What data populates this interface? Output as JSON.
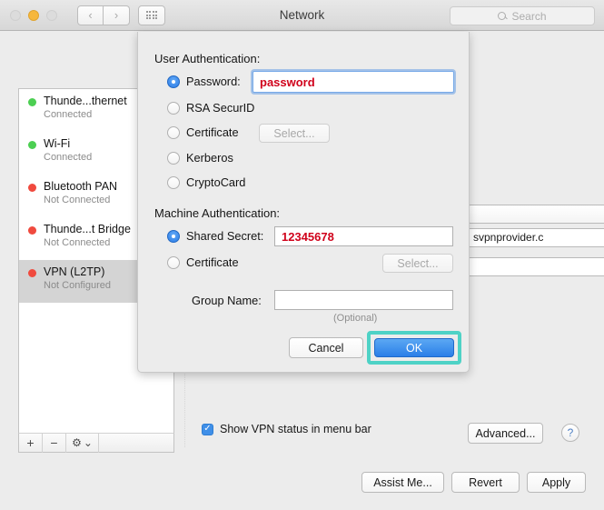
{
  "titlebar": {
    "title": "Network",
    "search_placeholder": "Search",
    "back_glyph": "‹",
    "forward_glyph": "›"
  },
  "sidebar": {
    "services": [
      {
        "name": "Thunde...thernet",
        "status": "Connected",
        "state": "green"
      },
      {
        "name": "Wi-Fi",
        "status": "Connected",
        "state": "green"
      },
      {
        "name": "Bluetooth PAN",
        "status": "Not Connected",
        "state": "red"
      },
      {
        "name": "Thunde...t Bridge",
        "status": "Not Connected",
        "state": "red"
      },
      {
        "name": "VPN (L2TP)",
        "status": "Not Configured",
        "state": "red"
      }
    ],
    "toolbar": {
      "add": "+",
      "remove": "−",
      "gear": "⚙",
      "gear_chevron": "⌄"
    }
  },
  "background_pane": {
    "server_address_value": "svpnprovider.c",
    "ellipsis_button": "..."
  },
  "footer": {
    "show_vpn_status_label": "Show VPN status in menu bar",
    "show_vpn_status_checked": true,
    "check_glyph": "✓",
    "advanced_label": "Advanced...",
    "help_label": "?",
    "assist_me_label": "Assist Me...",
    "revert_label": "Revert",
    "apply_label": "Apply"
  },
  "dialog": {
    "user_auth_title": "User Authentication:",
    "user_auth_options": [
      {
        "label": "Password:",
        "selected": true
      },
      {
        "label": "RSA SecurID",
        "selected": false
      },
      {
        "label": "Certificate",
        "selected": false
      },
      {
        "label": "Kerberos",
        "selected": false
      },
      {
        "label": "CryptoCard",
        "selected": false
      }
    ],
    "password_value": "password",
    "user_cert_select_label": "Select...",
    "machine_auth_title": "Machine Authentication:",
    "machine_auth_options": [
      {
        "label": "Shared Secret:",
        "selected": true
      },
      {
        "label": "Certificate",
        "selected": false
      }
    ],
    "shared_secret_value": "12345678",
    "machine_cert_select_label": "Select...",
    "group_name_label": "Group Name:",
    "group_name_value": "",
    "group_name_hint": "(Optional)",
    "cancel_label": "Cancel",
    "ok_label": "OK",
    "highlight_color": "#4ed2c6"
  }
}
